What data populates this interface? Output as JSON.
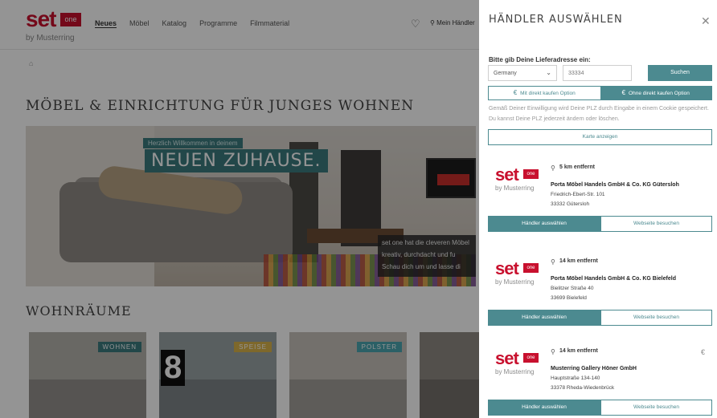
{
  "site": {
    "logo_text": "set",
    "logo_badge": "one",
    "logo_sub": "by Musterring",
    "nav": [
      "Neues",
      "Möbel",
      "Katalog",
      "Programme",
      "Filmmaterial"
    ],
    "store_link": "Mein Händler",
    "breadcrumb": "⌂",
    "hero_title": "MÖBEL & EINRICHTUNG FÜR JUNGES WOHNEN",
    "hero_tag": "Herzlich Willkommen in deinem",
    "hero_big": "NEUEN ZUHAUSE.",
    "hero_copy": [
      "set one hat die cleveren Möbel",
      "kreativ, durchdacht und fu",
      "Schau dich um und lasse di"
    ],
    "rooms_title": "WOHNRÄUME",
    "rooms": [
      {
        "tag": "WOHNEN",
        "color": "#3b7a7f"
      },
      {
        "tag": "",
        "color": "#3b7a7f"
      },
      {
        "tag": "SPEISE",
        "color": "#d9b44a"
      },
      {
        "tag": "POLSTER",
        "color": "#4aa6b0"
      },
      {
        "tag": "",
        "color": "#777"
      }
    ],
    "room_number": "8"
  },
  "panel": {
    "title": "HÄNDLER AUSWÄHLEN",
    "address_label": "Bitte gib Deine Lieferadresse ein:",
    "country": "Germany",
    "zip": "33334",
    "search_label": "Suchen",
    "option_with": "Mit direkt kaufen Option",
    "option_without": "Ohne direkt kaufen Option",
    "consent_text": "Gemäß Deiner Einwilligung wird Deine PLZ durch Eingabe in einem Cookie gespeichert. Du kannst Deine PLZ jederzeit ändern oder löschen.",
    "map_label": "Karte anzeigen",
    "dealers": [
      {
        "distance": "5 km entfernt",
        "name": "Porta Möbel Handels GmbH & Co. KG Gütersloh",
        "street": "Friedrich-Ebert-Str. 101",
        "city": "33332 Gütersloh",
        "euro": ""
      },
      {
        "distance": "14 km entfernt",
        "name": "Porta Möbel Handels GmbH & Co. KG Bielefeld",
        "street": "Bielitzer Straße 40",
        "city": "33699 Bielefeld",
        "euro": ""
      },
      {
        "distance": "14 km entfernt",
        "name": "Musterring Gallery Höner GmbH",
        "street": "Hauptstraße 134-140",
        "city": "33378 Rheda-Wiedenbrück",
        "euro": "€"
      }
    ],
    "select_label": "Händler auswählen",
    "website_label": "Webseite besuchen"
  },
  "colors": {
    "accent": "#4c8a90",
    "brand_red": "#c8102e"
  }
}
